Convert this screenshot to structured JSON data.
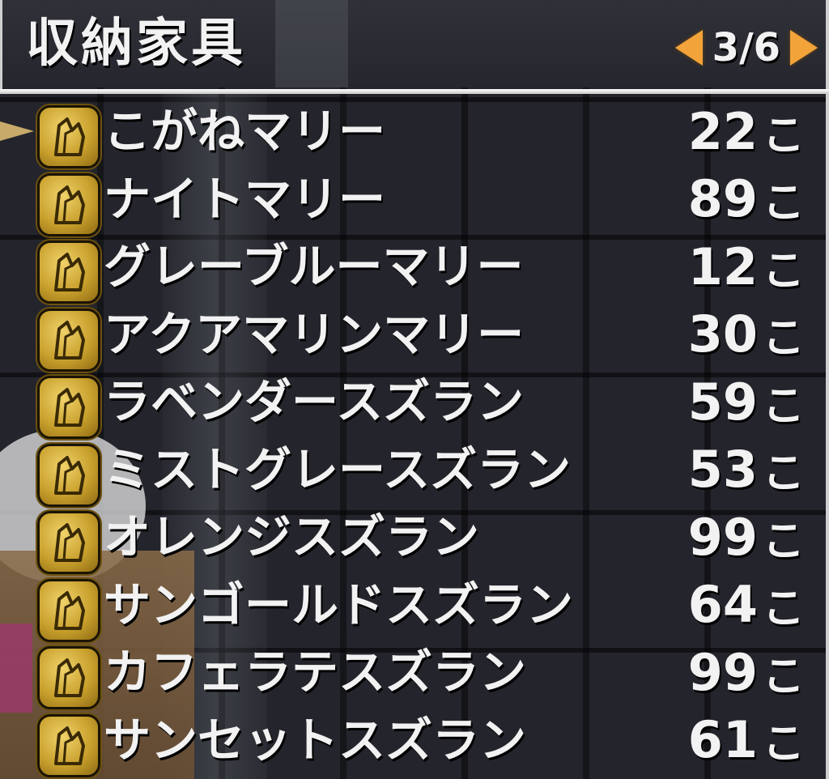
{
  "header": {
    "title": "収納家具",
    "page": "3/6"
  },
  "items": [
    {
      "name": "こがねマリー",
      "qty": "22",
      "unit": "こ",
      "selected": true
    },
    {
      "name": "ナイトマリー",
      "qty": "89",
      "unit": "こ"
    },
    {
      "name": "グレーブルーマリー",
      "qty": "12",
      "unit": "こ"
    },
    {
      "name": "アクアマリンマリー",
      "qty": "30",
      "unit": "こ"
    },
    {
      "name": "ラベンダースズラン",
      "qty": "59",
      "unit": "こ"
    },
    {
      "name": "ミストグレースズラン",
      "qty": "53",
      "unit": "こ"
    },
    {
      "name": "オレンジスズラン",
      "qty": "99",
      "unit": "こ"
    },
    {
      "name": "サンゴールドスズラン",
      "qty": "64",
      "unit": "こ"
    },
    {
      "name": "カフェラテスズラン",
      "qty": "99",
      "unit": "こ"
    },
    {
      "name": "サンセットスズラン",
      "qty": "61",
      "unit": "こ"
    }
  ],
  "icons": {
    "item": "gold-crystal-item-icon",
    "prev": "triangle-left-icon",
    "next": "triangle-right-icon",
    "cursor": "selection-cursor-icon"
  },
  "colors": {
    "accent": "#f2a43a",
    "text": "#f2f2f2",
    "icon_gold": "#c9a12e"
  }
}
